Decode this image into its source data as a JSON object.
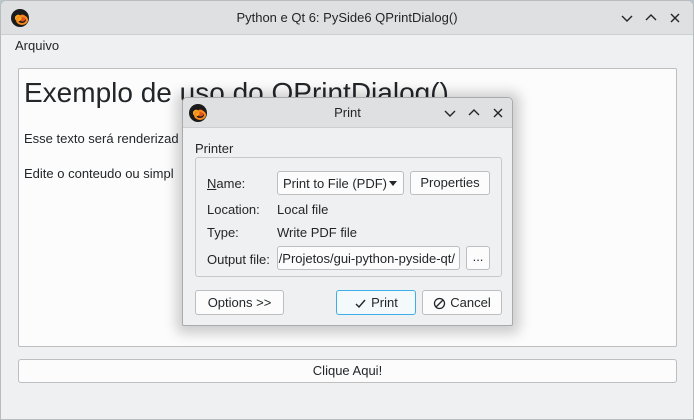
{
  "window": {
    "title": "Python e Qt 6: PySide6 QPrintDialog()",
    "controls": [
      "minimize",
      "maximize",
      "close"
    ]
  },
  "menubar": {
    "items": [
      {
        "label": "Arquivo"
      }
    ]
  },
  "editor": {
    "heading": "Exemplo de uso do QPrintDialog()",
    "line1": "Esse texto será renderizad",
    "line2": "Edite o conteudo ou simpl"
  },
  "main_button": {
    "label": "Clique Aqui!"
  },
  "print_dialog": {
    "title": "Print",
    "group_label": "Printer",
    "name_label": "Name:",
    "name_label_mnemonic": "N",
    "name_label_rest": "ame:",
    "printer_selected": "Print to File (PDF)",
    "properties_button": "Properties",
    "properties_mnemonic": "r",
    "location_label": "Location:",
    "location_value": "Local file",
    "type_label": "Type:",
    "type_value": "Write PDF file",
    "output_label": "Output file:",
    "output_value": ":/Projetos/gui-python-pyside-qt/",
    "browse_button": "...",
    "options_button": "Options >>",
    "print_button": "Print",
    "cancel_button": "Cancel"
  },
  "colors": {
    "accent": "#3daee9",
    "window_bg": "#eff0f1",
    "titlebar_bg": "#dee0e2"
  },
  "icons": {
    "app": "python-qt-logo-icon",
    "print": "check-icon",
    "cancel": "cancel-circle-icon"
  }
}
